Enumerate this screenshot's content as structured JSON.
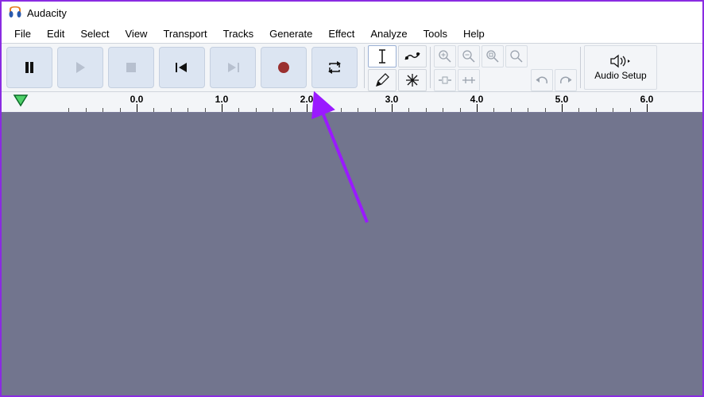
{
  "title": "Audacity",
  "menu": [
    "File",
    "Edit",
    "Select",
    "View",
    "Transport",
    "Tracks",
    "Generate",
    "Effect",
    "Analyze",
    "Tools",
    "Help"
  ],
  "transport": {
    "pause": "Pause",
    "play": "Play",
    "stop": "Stop",
    "skip_start": "Skip to Start",
    "skip_end": "Skip to End",
    "record": "Record",
    "loop": "Enable Looping"
  },
  "audio_setup_label": "Audio Setup",
  "timeline": {
    "start": 0.0,
    "labels": [
      "0.0",
      "1.0",
      "2.0",
      "3.0",
      "4.0",
      "5.0",
      "6.0"
    ]
  },
  "annotation": {
    "target": "record-button",
    "color": "#9a1aff"
  }
}
